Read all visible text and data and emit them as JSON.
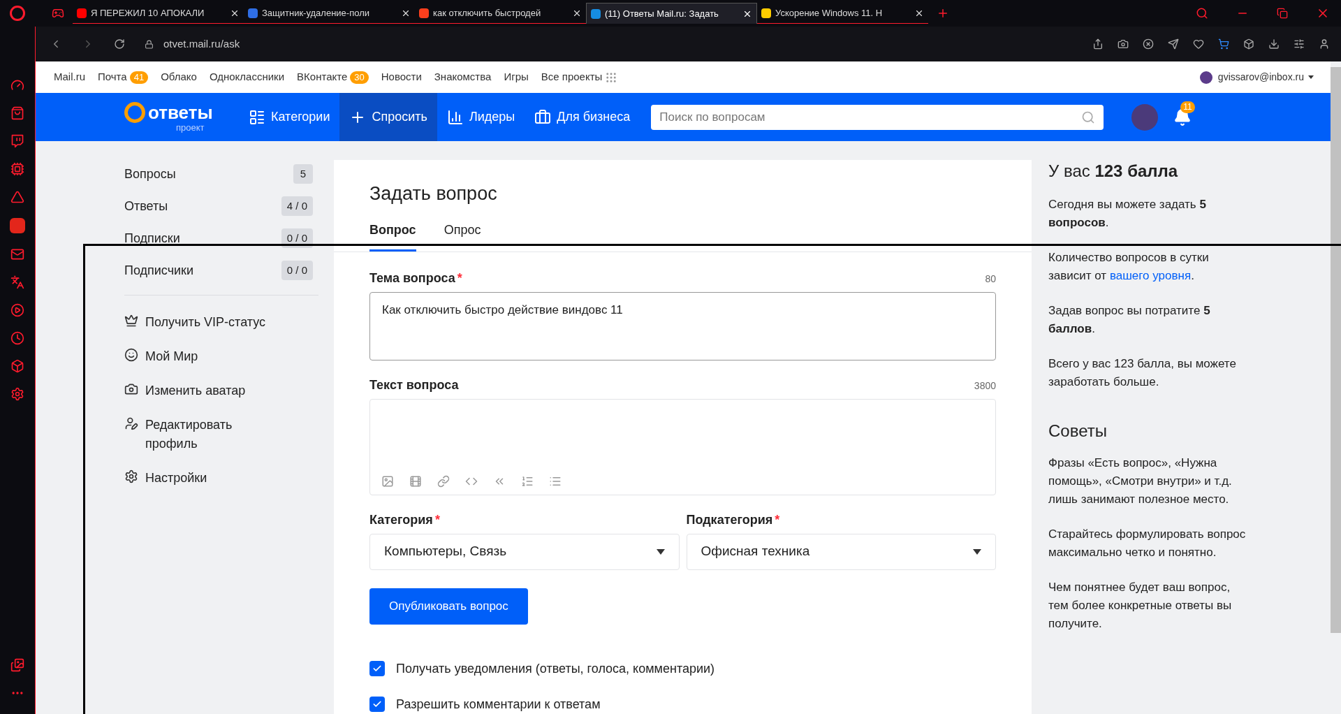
{
  "browser": {
    "tabs": [
      {
        "title": "Я ПЕРЕЖИЛ 10 АПОКАЛИ",
        "selected": false
      },
      {
        "title": "Защитник-удаление-поли",
        "selected": false
      },
      {
        "title": "как отключить быстродей",
        "selected": false
      },
      {
        "title": "(11) Ответы Mail.ru: Задать",
        "selected": true
      },
      {
        "title": "Ускорение Windows 11. Н",
        "selected": false
      }
    ],
    "url": "otvet.mail.ru/ask"
  },
  "portal_bar": {
    "links": [
      {
        "label": "Mail.ru"
      },
      {
        "label": "Почта",
        "badge": "41"
      },
      {
        "label": "Облако"
      },
      {
        "label": "Одноклассники"
      },
      {
        "label": "ВКонтакте",
        "badge": "30"
      },
      {
        "label": "Новости"
      },
      {
        "label": "Знакомства"
      },
      {
        "label": "Игры"
      },
      {
        "label": "Все проекты"
      }
    ],
    "user": "gvissarov@inbox.ru"
  },
  "header": {
    "logo": "ответы",
    "logo_sub": "проект",
    "nav": [
      {
        "label": "Категории",
        "selected": false
      },
      {
        "label": "Спросить",
        "selected": true
      },
      {
        "label": "Лидеры",
        "selected": false
      },
      {
        "label": "Для бизнеса",
        "selected": false
      }
    ],
    "search": {
      "placeholder": "Поиск по вопросам"
    },
    "notifications": "11"
  },
  "left_nav": {
    "counters": [
      {
        "label": "Вопросы",
        "count": "5"
      },
      {
        "label": "Ответы",
        "count": "4 / 0"
      },
      {
        "label": "Подписки",
        "count": "0 / 0"
      },
      {
        "label": "Подписчики",
        "count": "0 / 0"
      }
    ],
    "links": [
      {
        "label": "Получить VIP-статус"
      },
      {
        "label": "Мой Мир"
      },
      {
        "label": "Изменить аватар"
      },
      {
        "label": "Редактировать профиль"
      },
      {
        "label": "Настройки"
      }
    ]
  },
  "form": {
    "title": "Задать вопрос",
    "tabs": [
      {
        "label": "Вопрос",
        "selected": true
      },
      {
        "label": "Опрос",
        "selected": false
      }
    ],
    "subject": {
      "label": "Тема вопроса",
      "required_mark": "*",
      "limit": "80",
      "value": "Как отключить быстро действие виндовс 11"
    },
    "body": {
      "label": "Текст вопроса",
      "limit": "3800"
    },
    "category": {
      "label": "Категория",
      "required_mark": "*",
      "value": "Компьютеры, Связь"
    },
    "subcategory": {
      "label": "Подкатегория",
      "required_mark": "*",
      "value": "Офисная техника"
    },
    "submit": "Опубликовать вопрос",
    "options": [
      {
        "label": "Получать уведомления (ответы, голоса, комментарии)",
        "checked": true
      },
      {
        "label": "Разрешить комментарии к ответам",
        "checked": true
      }
    ]
  },
  "info": {
    "title": "У вас **123 балла**",
    "paragraphs": [
      {
        "text": "Сегодня вы можете задать **5 вопросов**."
      },
      {
        "text": "Количество вопросов в сутки зависит от ",
        "link": "вашего уровня",
        "after": "."
      },
      {
        "text": "Задав вопрос вы потратите **5 баллов**."
      },
      {
        "text": "Всего у вас 123 балла, вы можете заработать больше."
      }
    ],
    "tips_title": "Советы",
    "tips": [
      "Фразы «Есть вопрос», «Нужна помощь», «Смотри внутри» и т.д. лишь занимают полезное место.",
      "Старайтесь формулировать вопрос максимально четко и понятно.",
      "Чем понятнее будет ваш вопрос, тем более конкретные ответы вы получите."
    ]
  }
}
